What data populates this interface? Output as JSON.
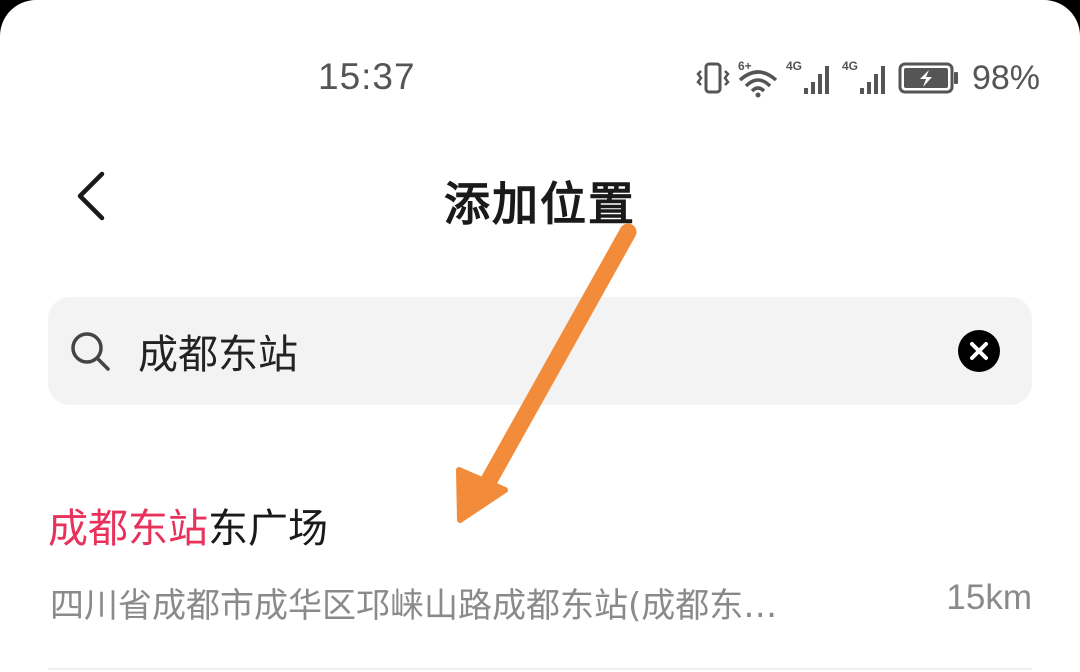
{
  "status_bar": {
    "time": "15:37",
    "battery_percent": "98%",
    "icons": [
      "vibrate-icon",
      "wifi-6-icon",
      "signal-4g-icon",
      "signal-4g-icon",
      "battery-charging-icon"
    ],
    "wifi_badge": "6+",
    "network_label_1": "4G",
    "network_label_2": "4G"
  },
  "header": {
    "title": "添加位置",
    "back_icon": "chevron-left-icon"
  },
  "search": {
    "value": "成都东站",
    "icon": "search-icon",
    "clear_icon": "clear-icon"
  },
  "results": [
    {
      "title_highlight": "成都东站",
      "title_rest": "东广场",
      "address": "四川省成都市成华区邛崃山路成都东站(成都东…",
      "distance": "15km"
    }
  ],
  "colors": {
    "highlight": "#e8315b",
    "arrow": "#f28c3a",
    "text_primary": "#1a1a1a",
    "text_secondary": "#8a8a8a",
    "search_bg": "#f3f3f3"
  }
}
